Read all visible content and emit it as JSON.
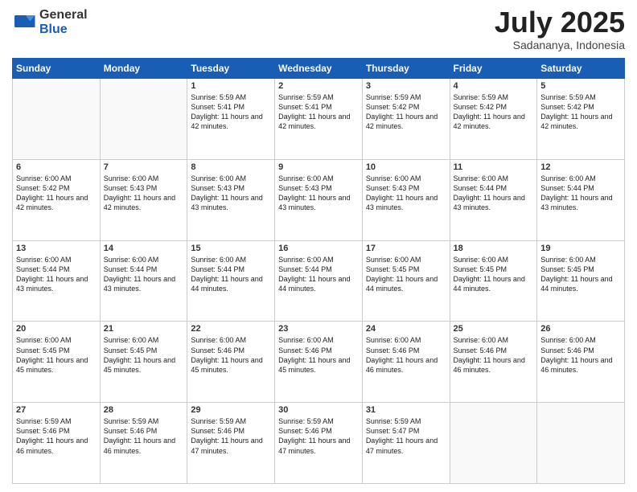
{
  "logo": {
    "general": "General",
    "blue": "Blue"
  },
  "header": {
    "month": "July 2025",
    "location": "Sadananya, Indonesia"
  },
  "weekdays": [
    "Sunday",
    "Monday",
    "Tuesday",
    "Wednesday",
    "Thursday",
    "Friday",
    "Saturday"
  ],
  "weeks": [
    [
      {
        "day": "",
        "info": ""
      },
      {
        "day": "",
        "info": ""
      },
      {
        "day": "1",
        "info": "Sunrise: 5:59 AM\nSunset: 5:41 PM\nDaylight: 11 hours and 42 minutes."
      },
      {
        "day": "2",
        "info": "Sunrise: 5:59 AM\nSunset: 5:41 PM\nDaylight: 11 hours and 42 minutes."
      },
      {
        "day": "3",
        "info": "Sunrise: 5:59 AM\nSunset: 5:42 PM\nDaylight: 11 hours and 42 minutes."
      },
      {
        "day": "4",
        "info": "Sunrise: 5:59 AM\nSunset: 5:42 PM\nDaylight: 11 hours and 42 minutes."
      },
      {
        "day": "5",
        "info": "Sunrise: 5:59 AM\nSunset: 5:42 PM\nDaylight: 11 hours and 42 minutes."
      }
    ],
    [
      {
        "day": "6",
        "info": "Sunrise: 6:00 AM\nSunset: 5:42 PM\nDaylight: 11 hours and 42 minutes."
      },
      {
        "day": "7",
        "info": "Sunrise: 6:00 AM\nSunset: 5:43 PM\nDaylight: 11 hours and 42 minutes."
      },
      {
        "day": "8",
        "info": "Sunrise: 6:00 AM\nSunset: 5:43 PM\nDaylight: 11 hours and 43 minutes."
      },
      {
        "day": "9",
        "info": "Sunrise: 6:00 AM\nSunset: 5:43 PM\nDaylight: 11 hours and 43 minutes."
      },
      {
        "day": "10",
        "info": "Sunrise: 6:00 AM\nSunset: 5:43 PM\nDaylight: 11 hours and 43 minutes."
      },
      {
        "day": "11",
        "info": "Sunrise: 6:00 AM\nSunset: 5:44 PM\nDaylight: 11 hours and 43 minutes."
      },
      {
        "day": "12",
        "info": "Sunrise: 6:00 AM\nSunset: 5:44 PM\nDaylight: 11 hours and 43 minutes."
      }
    ],
    [
      {
        "day": "13",
        "info": "Sunrise: 6:00 AM\nSunset: 5:44 PM\nDaylight: 11 hours and 43 minutes."
      },
      {
        "day": "14",
        "info": "Sunrise: 6:00 AM\nSunset: 5:44 PM\nDaylight: 11 hours and 43 minutes."
      },
      {
        "day": "15",
        "info": "Sunrise: 6:00 AM\nSunset: 5:44 PM\nDaylight: 11 hours and 44 minutes."
      },
      {
        "day": "16",
        "info": "Sunrise: 6:00 AM\nSunset: 5:44 PM\nDaylight: 11 hours and 44 minutes."
      },
      {
        "day": "17",
        "info": "Sunrise: 6:00 AM\nSunset: 5:45 PM\nDaylight: 11 hours and 44 minutes."
      },
      {
        "day": "18",
        "info": "Sunrise: 6:00 AM\nSunset: 5:45 PM\nDaylight: 11 hours and 44 minutes."
      },
      {
        "day": "19",
        "info": "Sunrise: 6:00 AM\nSunset: 5:45 PM\nDaylight: 11 hours and 44 minutes."
      }
    ],
    [
      {
        "day": "20",
        "info": "Sunrise: 6:00 AM\nSunset: 5:45 PM\nDaylight: 11 hours and 45 minutes."
      },
      {
        "day": "21",
        "info": "Sunrise: 6:00 AM\nSunset: 5:45 PM\nDaylight: 11 hours and 45 minutes."
      },
      {
        "day": "22",
        "info": "Sunrise: 6:00 AM\nSunset: 5:46 PM\nDaylight: 11 hours and 45 minutes."
      },
      {
        "day": "23",
        "info": "Sunrise: 6:00 AM\nSunset: 5:46 PM\nDaylight: 11 hours and 45 minutes."
      },
      {
        "day": "24",
        "info": "Sunrise: 6:00 AM\nSunset: 5:46 PM\nDaylight: 11 hours and 46 minutes."
      },
      {
        "day": "25",
        "info": "Sunrise: 6:00 AM\nSunset: 5:46 PM\nDaylight: 11 hours and 46 minutes."
      },
      {
        "day": "26",
        "info": "Sunrise: 6:00 AM\nSunset: 5:46 PM\nDaylight: 11 hours and 46 minutes."
      }
    ],
    [
      {
        "day": "27",
        "info": "Sunrise: 5:59 AM\nSunset: 5:46 PM\nDaylight: 11 hours and 46 minutes."
      },
      {
        "day": "28",
        "info": "Sunrise: 5:59 AM\nSunset: 5:46 PM\nDaylight: 11 hours and 46 minutes."
      },
      {
        "day": "29",
        "info": "Sunrise: 5:59 AM\nSunset: 5:46 PM\nDaylight: 11 hours and 47 minutes."
      },
      {
        "day": "30",
        "info": "Sunrise: 5:59 AM\nSunset: 5:46 PM\nDaylight: 11 hours and 47 minutes."
      },
      {
        "day": "31",
        "info": "Sunrise: 5:59 AM\nSunset: 5:47 PM\nDaylight: 11 hours and 47 minutes."
      },
      {
        "day": "",
        "info": ""
      },
      {
        "day": "",
        "info": ""
      }
    ]
  ]
}
